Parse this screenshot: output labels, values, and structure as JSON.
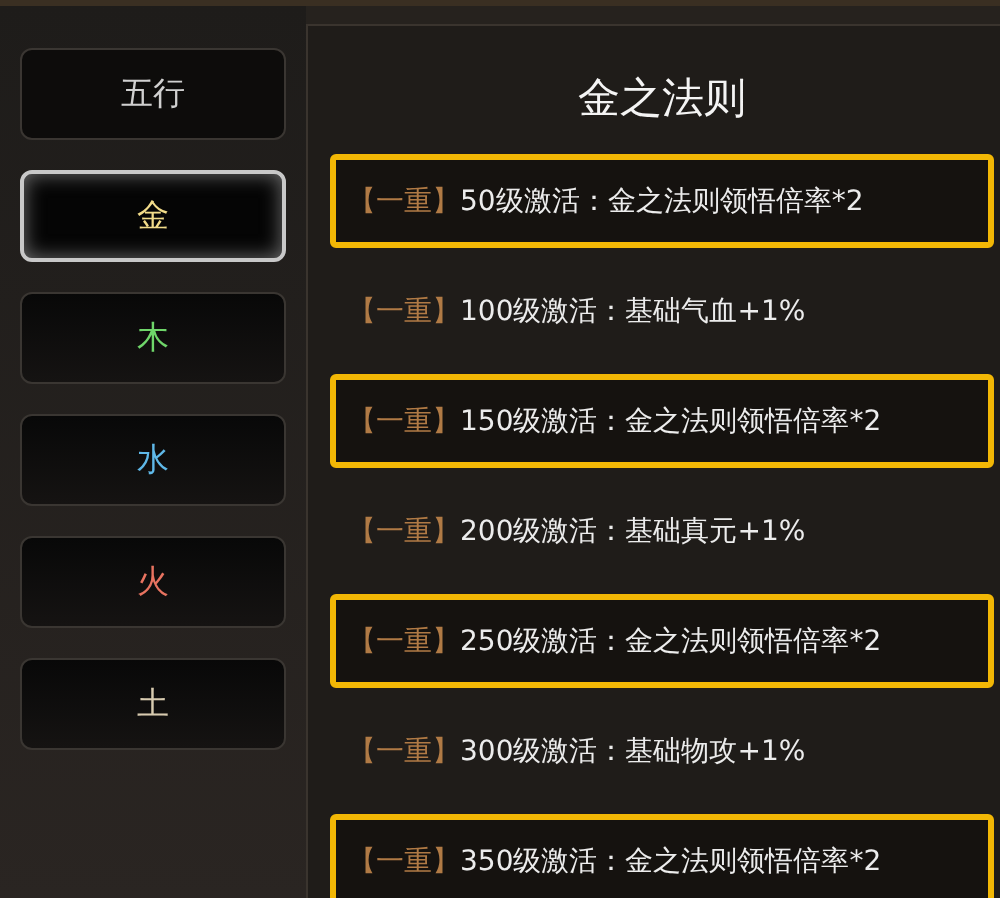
{
  "sidebar": {
    "header": "五行",
    "tabs": [
      {
        "label": "金",
        "selected": true,
        "color": "#f2dc8a"
      },
      {
        "label": "木",
        "selected": false,
        "color": "#6fd66a"
      },
      {
        "label": "水",
        "selected": false,
        "color": "#5fb8e8"
      },
      {
        "label": "火",
        "selected": false,
        "color": "#e87360"
      },
      {
        "label": "土",
        "selected": false,
        "color": "#d8cbb0"
      }
    ]
  },
  "panel": {
    "title": "金之法则",
    "rows": [
      {
        "rank": "【一重】",
        "text": "50级激活：金之法则领悟倍率*2",
        "highlighted": true
      },
      {
        "rank": "【一重】",
        "text": "100级激活：基础气血+1%",
        "highlighted": false
      },
      {
        "rank": "【一重】",
        "text": "150级激活：金之法则领悟倍率*2",
        "highlighted": true
      },
      {
        "rank": "【一重】",
        "text": "200级激活：基础真元+1%",
        "highlighted": false
      },
      {
        "rank": "【一重】",
        "text": "250级激活：金之法则领悟倍率*2",
        "highlighted": true
      },
      {
        "rank": "【一重】",
        "text": "300级激活：基础物攻+1%",
        "highlighted": false
      },
      {
        "rank": "【一重】",
        "text": "350级激活：金之法则领悟倍率*2",
        "highlighted": true
      }
    ]
  }
}
